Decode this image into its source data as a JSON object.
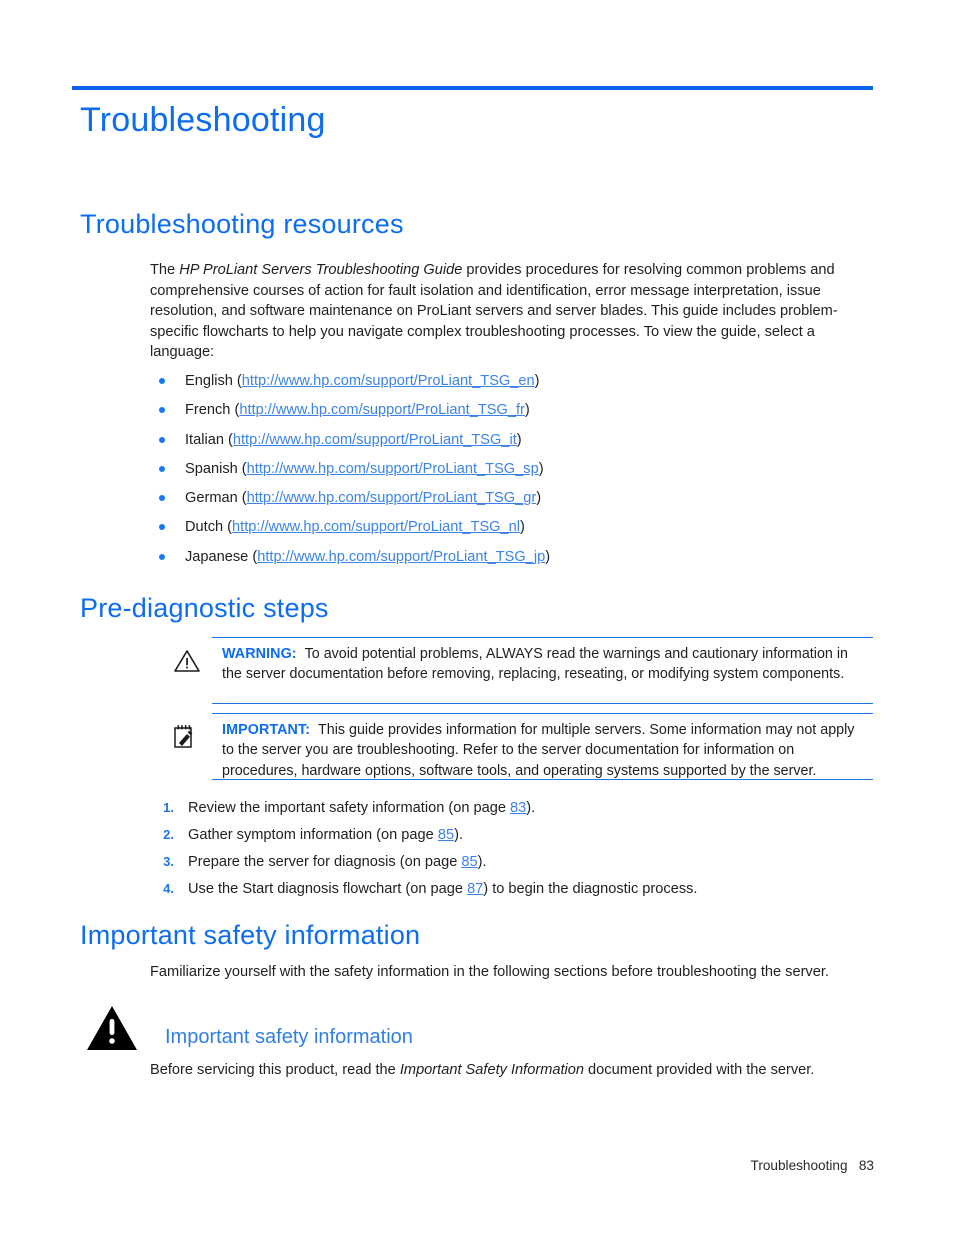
{
  "page": {
    "title": "Troubleshooting",
    "accent_color": "#0d6df0",
    "rule_color": "#1878e0",
    "link_color": "#3b83e8",
    "body_color": "#1f1f1f"
  },
  "sections": {
    "resources": {
      "heading": "Troubleshooting resources",
      "intro_before_italic": "The ",
      "intro_italic": "HP ProLiant Servers Troubleshooting Guide",
      "intro_after_italic": " provides procedures for resolving common problems and comprehensive courses of action for fault isolation and identification, error message interpretation, issue resolution, and software maintenance on ProLiant servers and server blades. This guide includes problem-specific flowcharts to help you navigate complex troubleshooting processes. To view the guide, select a language:",
      "languages": [
        {
          "label": "English",
          "url": "http://www.hp.com/support/ProLiant_TSG_en"
        },
        {
          "label": "French",
          "url": "http://www.hp.com/support/ProLiant_TSG_fr"
        },
        {
          "label": "Italian",
          "url": "http://www.hp.com/support/ProLiant_TSG_it"
        },
        {
          "label": "Spanish",
          "url": "http://www.hp.com/support/ProLiant_TSG_sp"
        },
        {
          "label": "German",
          "url": "http://www.hp.com/support/ProLiant_TSG_gr"
        },
        {
          "label": "Dutch",
          "url": "http://www.hp.com/support/ProLiant_TSG_nl"
        },
        {
          "label": "Japanese",
          "url": "http://www.hp.com/support/ProLiant_TSG_jp"
        }
      ]
    },
    "prediagnostic": {
      "heading": "Pre-diagnostic steps",
      "warning": {
        "label": "WARNING:",
        "text": "To avoid potential problems, ALWAYS read the warnings and cautionary information in the server documentation before removing, replacing, reseating, or modifying system components."
      },
      "important": {
        "label": "IMPORTANT:",
        "text": "This guide provides information for multiple servers. Some information may not apply to the server you are troubleshooting. Refer to the server documentation for information on procedures, hardware options, software tools, and operating systems supported by the server."
      },
      "steps": [
        {
          "number": "1.",
          "text_before": "Review the important safety information (on page ",
          "page": "83",
          "text_after": ")."
        },
        {
          "number": "2.",
          "text_before": "Gather symptom information (on page ",
          "page": "85",
          "text_after": ")."
        },
        {
          "number": "3.",
          "text_before": "Prepare the server for diagnosis (on page ",
          "page": "85",
          "text_after": ")."
        },
        {
          "number": "4.",
          "text_before": "Use the Start diagnosis flowchart (on page ",
          "page": "87",
          "text_after": ") to begin the diagnostic process."
        }
      ]
    },
    "safety": {
      "heading": "Important safety information",
      "intro": "Familiarize yourself with the safety information in the following sections before troubleshooting the server.",
      "subheading": "Important safety information",
      "body_before_italic": "Before servicing this product, read the ",
      "body_italic": "Important Safety Information",
      "body_after_italic": " document provided with the server."
    }
  },
  "footer": {
    "label": "Troubleshooting",
    "page_number": "83"
  }
}
